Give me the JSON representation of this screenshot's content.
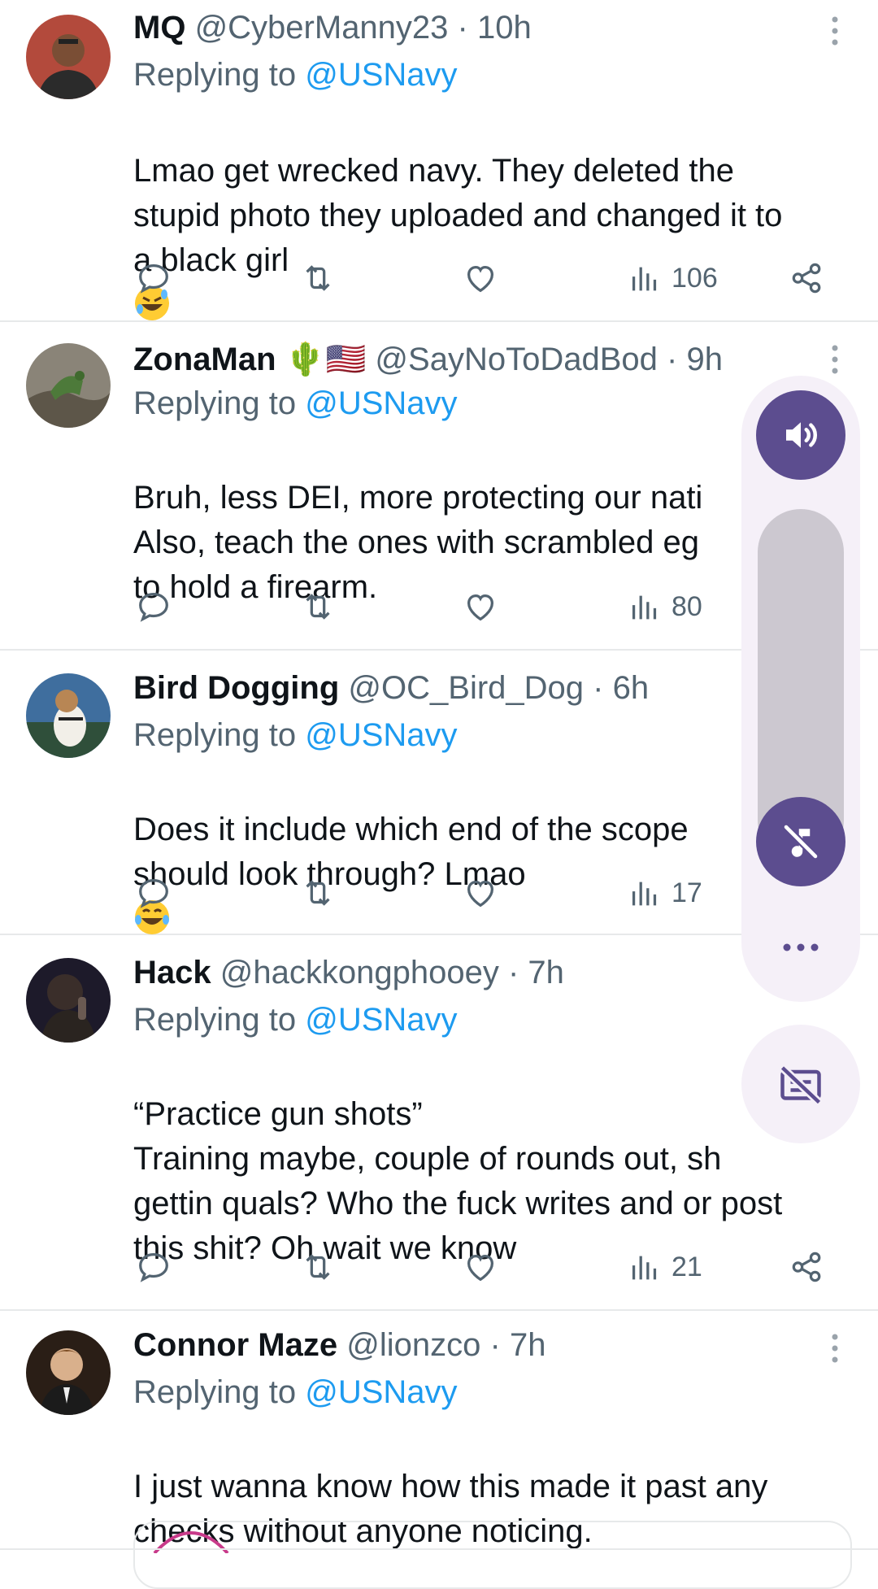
{
  "replying_label": "Replying to",
  "tweets": [
    {
      "name": "MQ",
      "badges": "",
      "handle": "@CyberManny23",
      "time": "10h",
      "reply_to": "@USNavy",
      "text": "Lmao get wrecked navy. They deleted the\nstupid photo they uploaded and changed it to\na black girl",
      "views": "106"
    },
    {
      "name": "ZonaMan",
      "badges": "🌵🇺🇸",
      "handle": "@SayNoToDadBod",
      "time": "9h",
      "reply_to": "@USNavy",
      "text": "Bruh, less DEI, more protecting our nati\nAlso, teach the ones with scrambled eg\nto hold a firearm.",
      "views": "80"
    },
    {
      "name": "Bird Dogging",
      "badges": "",
      "handle": "@OC_Bird_Dog",
      "time": "6h",
      "reply_to": "@USNavy",
      "text": "Does it include which end of the scope\nshould look through? Lmao",
      "views": "17"
    },
    {
      "name": "Hack",
      "badges": "",
      "handle": "@hackkongphooey",
      "time": "7h",
      "reply_to": "@USNavy",
      "text": "“Practice gun shots”\nTraining maybe, couple of rounds out, sh\ngettin quals? Who the fuck writes and or post\nthis shit? Oh wait we know",
      "views": "21"
    },
    {
      "name": "Connor Maze",
      "badges": "",
      "handle": "@lionzco",
      "time": "7h",
      "reply_to": "@USNavy",
      "text": "I just wanna know how this made it past any\nchecks without anyone noticing.",
      "views": ""
    }
  ],
  "icons": {
    "reply": "comment-icon",
    "retweet": "retweet-icon",
    "like": "heart-icon",
    "views": "views-icon",
    "share": "share-icon",
    "more": "more-vertical-icon"
  },
  "colors": {
    "accent": "#1d9bf0",
    "secondary_text": "#536471",
    "volume_button": "#5c4d8f"
  }
}
